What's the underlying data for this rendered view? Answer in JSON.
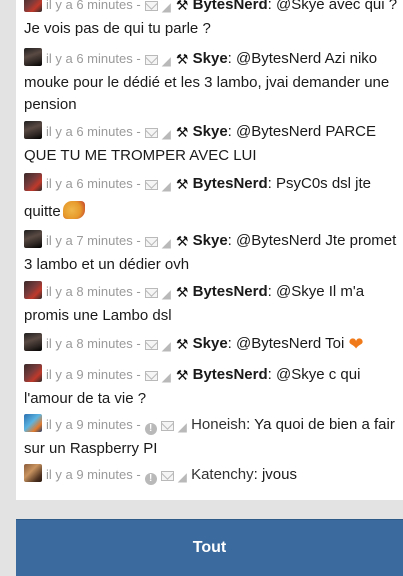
{
  "messages": [
    {
      "avatar": "bytes",
      "time": "il y a 6 minutes",
      "sep": " -",
      "mod": true,
      "warn": false,
      "user": "BytesNerd",
      "text": ": @Skye avec qui ?",
      "line2": "Je vois pas de qui tu parle ?"
    },
    {
      "avatar": "skye",
      "time": "il y a 6 minutes",
      "sep": " -",
      "mod": true,
      "warn": false,
      "user": "Skye",
      "text": ": @BytesNerd Azi niko",
      "line2": "mouke pour le dédié et les 3 lambo, jvai demander une",
      "line3": "pension"
    },
    {
      "avatar": "skye",
      "time": "il y a 6 minutes",
      "sep": " -",
      "mod": true,
      "warn": false,
      "user": "Skye",
      "text": ": @BytesNerd PARCE",
      "line2": "QUE TU ME TROMPER AVEC LUI"
    },
    {
      "avatar": "bytes",
      "time": "il y a 6 minutes",
      "sep": " -",
      "mod": true,
      "warn": false,
      "user": "BytesNerd",
      "text": ": PsyC0s dsl jte",
      "line2": "quitte"
    },
    {
      "avatar": "skye",
      "time": "il y a 7 minutes",
      "sep": " -",
      "mod": true,
      "warn": false,
      "user": "Skye",
      "text": ": @BytesNerd Jte promet",
      "line2": "3 lambo et un dédier ovh"
    },
    {
      "avatar": "bytes",
      "time": "il y a 8 minutes",
      "sep": " -",
      "mod": true,
      "warn": false,
      "user": "BytesNerd",
      "text": ": @Skye Il m'a",
      "line2": "promis une Lambo dsl"
    },
    {
      "avatar": "skye",
      "time": "il y a 8 minutes",
      "sep": " -",
      "mod": true,
      "warn": false,
      "user": "Skye",
      "text": ": @BytesNerd Toi"
    },
    {
      "avatar": "bytes",
      "time": "il y a 9 minutes",
      "sep": " -",
      "mod": true,
      "warn": false,
      "user": "BytesNerd",
      "text": ": @Skye c qui",
      "line2": "l'amour de ta vie ?"
    },
    {
      "avatar": "hon",
      "time": "il y a 9 minutes",
      "sep": " -",
      "mod": false,
      "warn": true,
      "user": "Honeish",
      "text": ": Ya quoi de bien a fair",
      "line2": "sur un Raspberry PI"
    },
    {
      "avatar": "kat",
      "time": "il y a 9 minutes",
      "sep": " -",
      "mod": false,
      "warn": true,
      "user": "Katenchy",
      "text": ": jvous"
    }
  ],
  "footer": {
    "button_label": "Tout"
  },
  "colors": {
    "button": "#3a6a9e",
    "heart": "#f07a1a"
  },
  "icons": {
    "mail": "envelope-icon",
    "tag": "tag-icon",
    "mod": "hammer-icon",
    "warn": "warning-icon"
  }
}
